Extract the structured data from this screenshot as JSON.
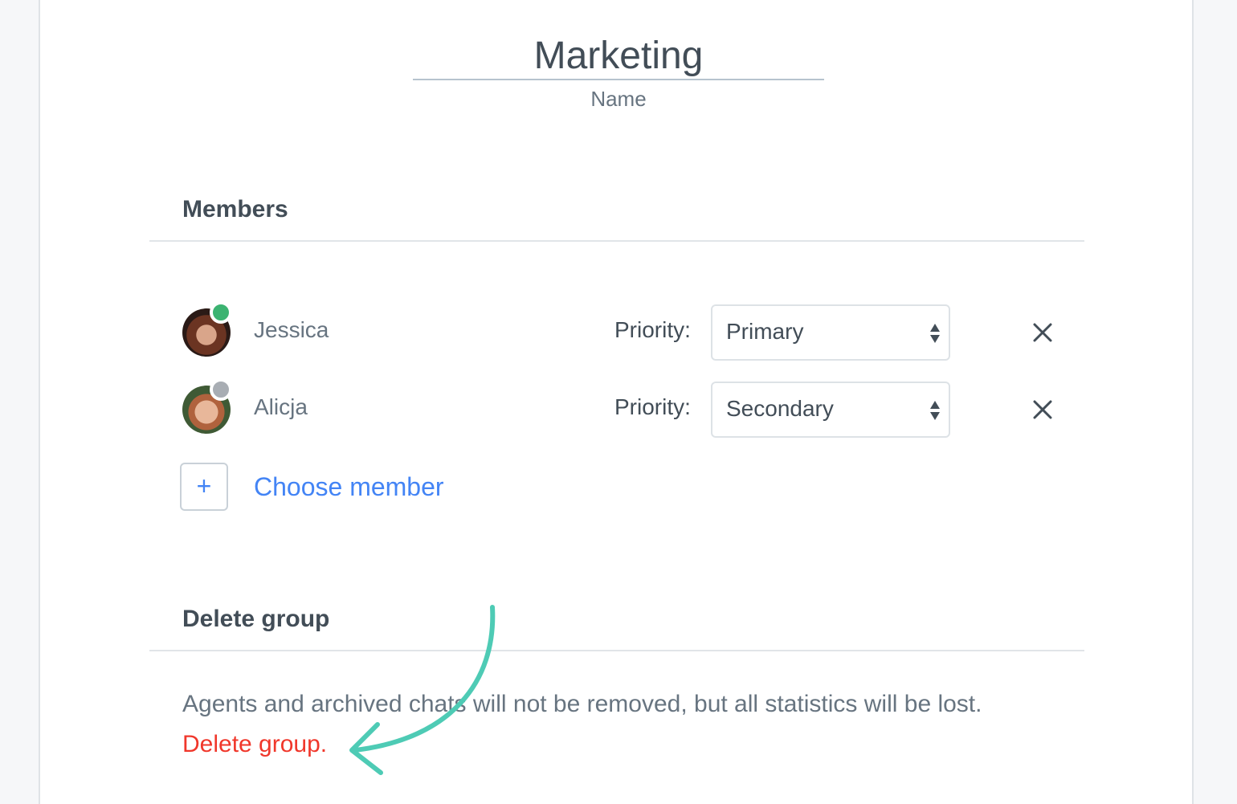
{
  "group": {
    "name_value": "Marketing",
    "name_label": "Name"
  },
  "members_section": {
    "title": "Members",
    "members": [
      {
        "name": "Jessica",
        "status": "online",
        "status_color": "#3cb371",
        "priority_label": "Priority:",
        "priority": "Primary"
      },
      {
        "name": "Alicja",
        "status": "offline",
        "status_color": "#a8adb3",
        "priority_label": "Priority:",
        "priority": "Secondary"
      }
    ],
    "add_icon": "plus-icon",
    "add_label": "Choose member"
  },
  "delete_section": {
    "title": "Delete group",
    "description": "Agents and archived chats will not be removed, but all statistics will be lost.",
    "link_label": "Delete group.",
    "link_color": "#f0372b"
  },
  "annotation": {
    "type": "curved-arrow",
    "color": "#4ecbb5",
    "points_to": "delete-group-link"
  },
  "colors": {
    "accent": "#4384f5",
    "text_primary": "#424d57",
    "text_secondary": "#677480"
  }
}
